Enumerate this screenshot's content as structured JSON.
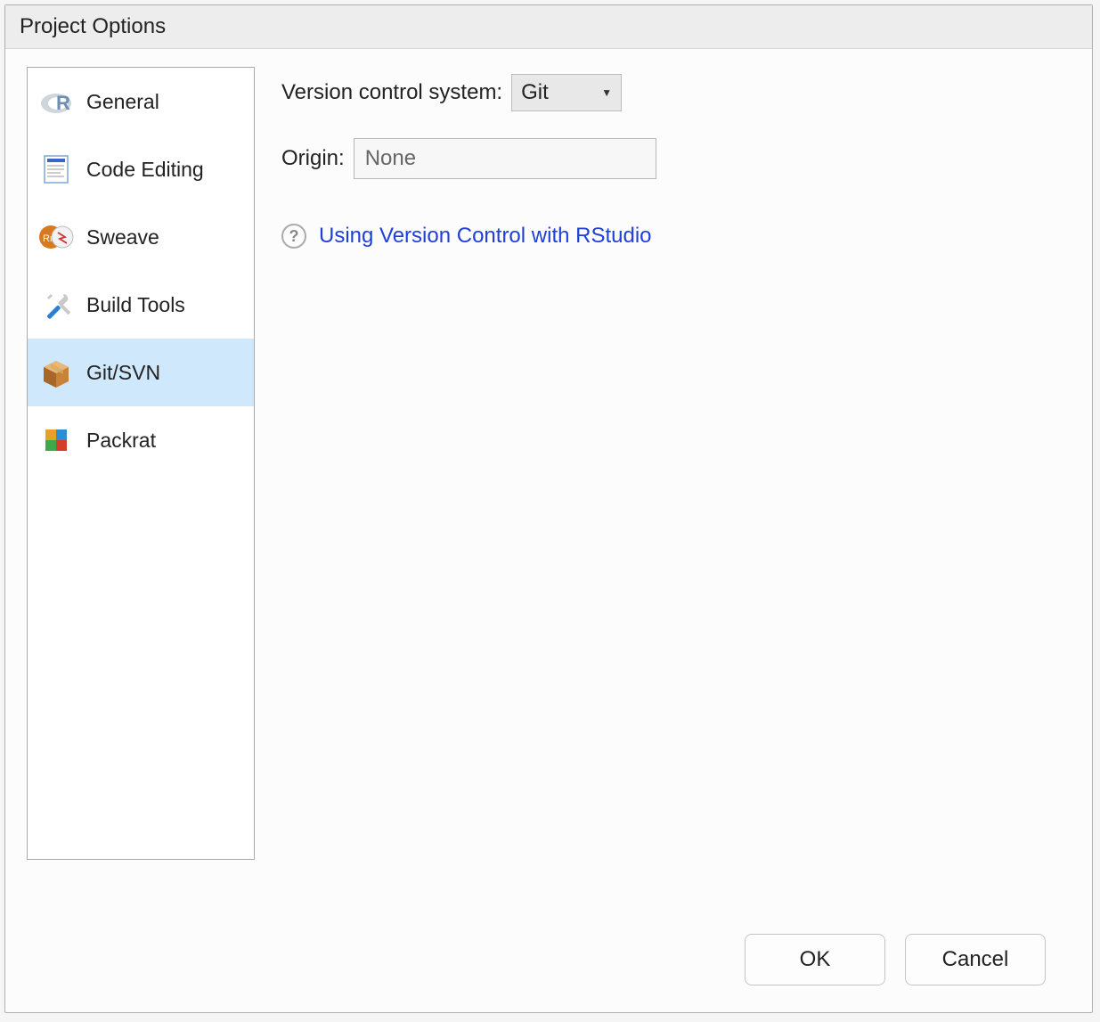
{
  "title": "Project Options",
  "sidebar": {
    "items": [
      {
        "label": "General"
      },
      {
        "label": "Code Editing"
      },
      {
        "label": "Sweave"
      },
      {
        "label": "Build Tools"
      },
      {
        "label": "Git/SVN"
      },
      {
        "label": "Packrat"
      }
    ]
  },
  "main": {
    "vcs_label": "Version control system:",
    "vcs_value": "Git",
    "origin_label": "Origin:",
    "origin_value": "None",
    "help_link": "Using Version Control with RStudio"
  },
  "footer": {
    "ok_label": "OK",
    "cancel_label": "Cancel"
  }
}
